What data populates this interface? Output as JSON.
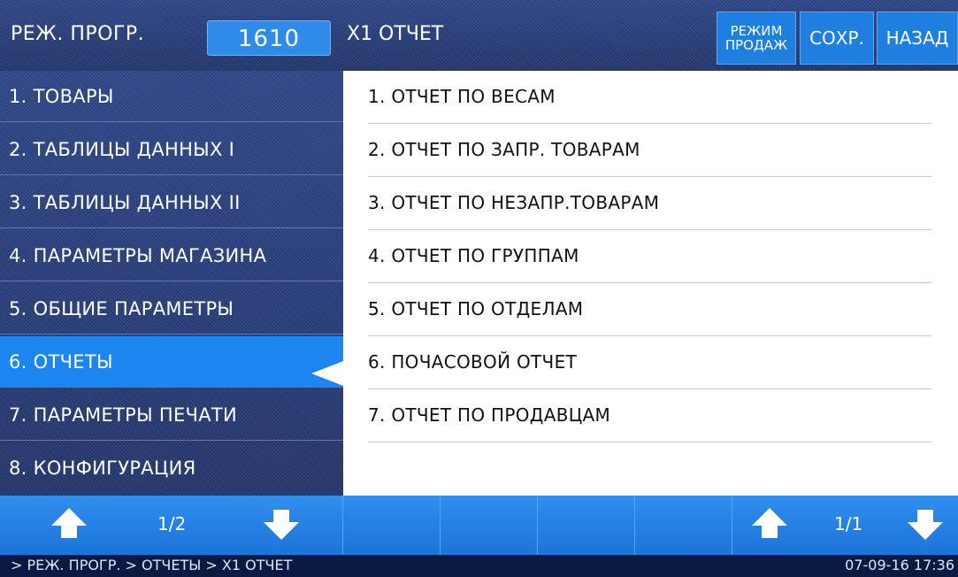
{
  "header": {
    "mode_label": "РЕЖ. ПРОГР.",
    "code": "1610",
    "title": "X1 ОТЧЕТ",
    "btn_sales_line1": "РЕЖИМ",
    "btn_sales_line2": "ПРОДАЖ",
    "btn_save": "СОХР.",
    "btn_back": "НАЗАД"
  },
  "menu": {
    "items": [
      {
        "label": "1. ТОВАРЫ"
      },
      {
        "label": "2. ТАБЛИЦЫ ДАННЫХ I"
      },
      {
        "label": "3. ТАБЛИЦЫ ДАННЫХ II"
      },
      {
        "label": "4. ПАРАМЕТРЫ МАГАЗИНА"
      },
      {
        "label": "5. ОБЩИЕ ПАРАМЕТРЫ"
      },
      {
        "label": "6. ОТЧЕТЫ"
      },
      {
        "label": "7. ПАРАМЕТРЫ ПЕЧАТИ"
      },
      {
        "label": "8. КОНФИГУРАЦИЯ"
      }
    ],
    "selected_index": 5
  },
  "submenu": {
    "items": [
      {
        "label": "1. ОТЧЕТ ПО ВЕСАМ"
      },
      {
        "label": "2. ОТЧЕТ ПО ЗАПР. ТОВАРАМ"
      },
      {
        "label": "3. ОТЧЕТ ПО НЕЗАПР.ТОВАРАМ"
      },
      {
        "label": "4. ОТЧЕТ ПО ГРУППАМ"
      },
      {
        "label": "5. ОТЧЕТ ПО ОТДЕЛАМ"
      },
      {
        "label": "6. ПОЧАСОВОЙ ОТЧЕТ"
      },
      {
        "label": "7. ОТЧЕТ ПО ПРОДАВЦАМ"
      }
    ]
  },
  "nav": {
    "left_page": "1/2",
    "right_page": "1/1",
    "icons": {
      "up": "arrow-up-icon",
      "down": "arrow-down-icon"
    }
  },
  "status": {
    "breadcrumb": "> РЕЖ. ПРОГР.  > ОТЧЕТЫ > X1 ОТЧЕТ",
    "datetime": "07-09-16  17:36"
  },
  "colors": {
    "accent": "#1d86f0",
    "background": "#2a3f7c",
    "panel": "#ffffff"
  }
}
